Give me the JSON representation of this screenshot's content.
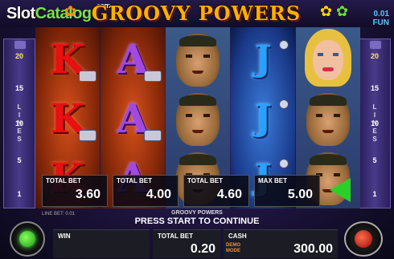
{
  "header": {
    "logo_main": "Slot",
    "logo_accent": "Catalog",
    "logo_sup": "com",
    "title": "GROOVY POWERS",
    "balance_amount": "0.01",
    "balance_label": "FUN"
  },
  "side": {
    "markers": [
      "20",
      "15",
      "10",
      "5",
      "1"
    ],
    "lines_label": [
      "L",
      "I",
      "N",
      "E",
      "S"
    ]
  },
  "reels": [
    [
      "K",
      "K",
      "K"
    ],
    [
      "A",
      "A",
      "A"
    ],
    [
      "man",
      "man",
      "man"
    ],
    [
      "J",
      "J",
      "J"
    ],
    [
      "lady",
      "man",
      "man"
    ]
  ],
  "bet_options": [
    {
      "label": "TOTAL BET",
      "value": "3.60"
    },
    {
      "label": "TOTAL BET",
      "value": "4.00"
    },
    {
      "label": "TOTAL BET",
      "value": "4.60"
    },
    {
      "label": "MAX BET",
      "value": "5.00"
    }
  ],
  "footer": {
    "line_bet": "LINE BET: 0.01",
    "game_name": "GROOVY POWERS",
    "message": "PRESS START TO CONTINUE",
    "win_label": "WIN",
    "win_value": "",
    "total_bet_label": "TOTAL BET",
    "total_bet_value": "0.20",
    "cash_label": "CASH",
    "cash_value": "300.00",
    "demo_line1": "DEMO",
    "demo_line2": "MODE"
  },
  "icons": {
    "spin": "spin-button-icon",
    "gamble": "gamble-button-icon",
    "play": "play-arrow-icon"
  },
  "colors": {
    "accent_green": "#2ad02a",
    "title_orange": "#ffb000",
    "balance_blue": "#58c8ff"
  }
}
